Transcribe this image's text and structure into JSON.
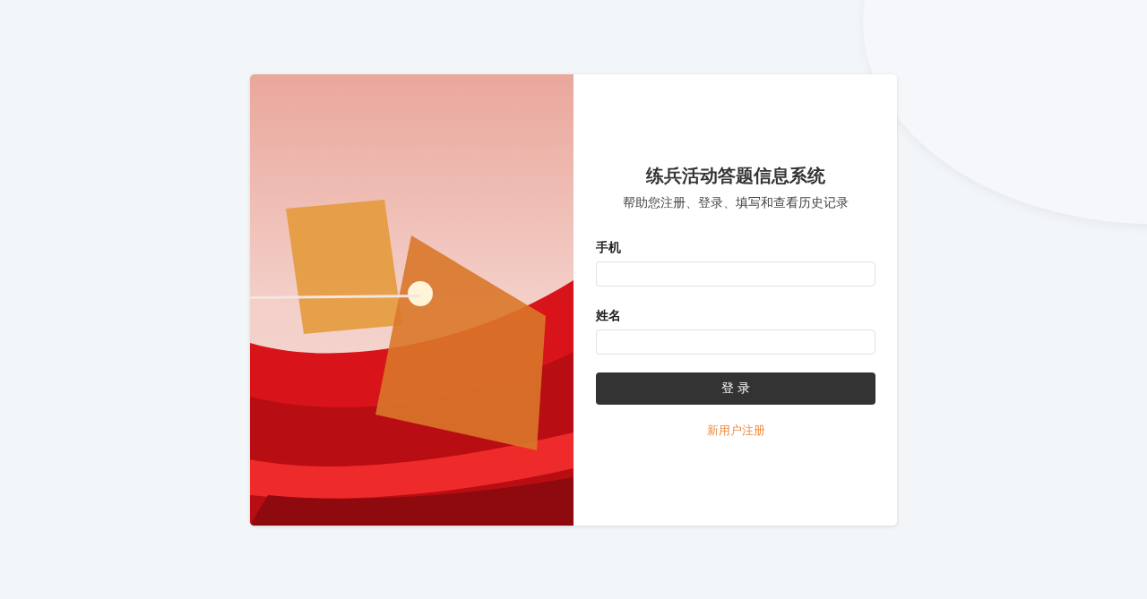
{
  "title": "练兵活动答题信息系统",
  "subtitle": "帮助您注册、登录、填写和查看历史记录",
  "fields": [
    {
      "label": "手机"
    },
    {
      "label": "姓名"
    }
  ],
  "login_button": "登 录",
  "register_link": "新用户注册"
}
